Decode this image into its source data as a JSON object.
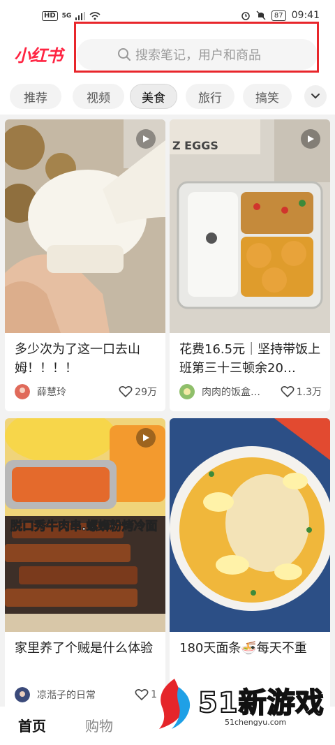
{
  "status_bar": {
    "hd": "HD",
    "signal": "5G",
    "battery": "87",
    "time": "09:41"
  },
  "app": {
    "logo": "小红书"
  },
  "search": {
    "placeholder": "搜索笔记，用户和商品"
  },
  "tabs": [
    {
      "label": "推荐",
      "active": false
    },
    {
      "label": "视频",
      "active": false
    },
    {
      "label": "美食",
      "active": true
    },
    {
      "label": "旅行",
      "active": false
    },
    {
      "label": "搞笑",
      "active": false
    }
  ],
  "feed": [
    {
      "title": "多少次为了这一口去山姆！！！！",
      "author": "薛慧玲",
      "likes": "29万",
      "is_video": true
    },
    {
      "title": "花费16.5元｜坚持带饭上班第三十三顿余20…",
      "author": "肉肉的饭盒…",
      "likes": "1.3万",
      "is_video": true
    },
    {
      "title": "家里养了个贼是什么体验",
      "author": "凉湉子的日常",
      "likes": "1",
      "is_video": true,
      "overlay": "脱口秀牛肉串.螺蛳粉烤冷面"
    },
    {
      "title": "180天面条🍜每天不重",
      "author": "",
      "likes": "",
      "is_video": false
    }
  ],
  "image_text": {
    "eggs_box": "Z EGGS"
  },
  "bottom_nav": {
    "home": "首页",
    "shop": "购物"
  },
  "watermark": {
    "brand": "51新游戏",
    "url": "51chengyu.com"
  },
  "colors": {
    "accent": "#ff2442",
    "highlight": "#e8262b"
  }
}
